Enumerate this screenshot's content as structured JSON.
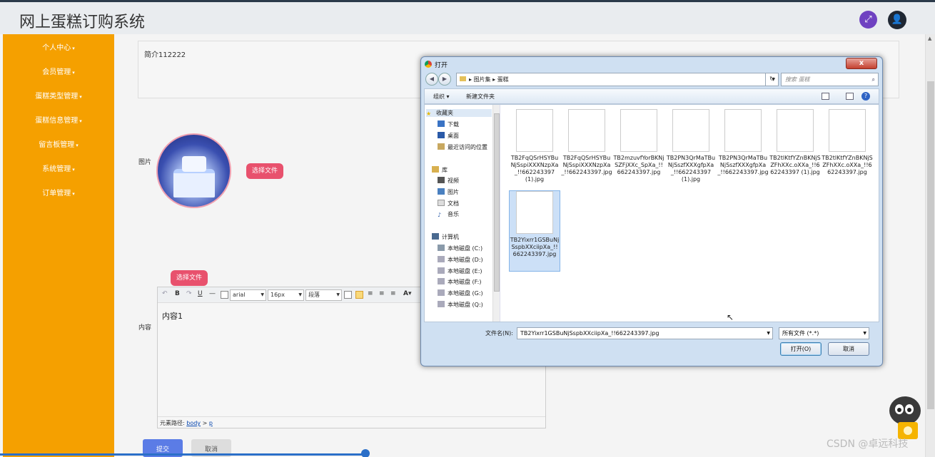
{
  "app": {
    "title": "网上蛋糕订购系统"
  },
  "header": {
    "fullscreen_icon": "expand-icon",
    "user_icon": "user-icon"
  },
  "sidebar": {
    "items": [
      {
        "label": "个人中心"
      },
      {
        "label": "会员管理"
      },
      {
        "label": "蛋糕类型管理"
      },
      {
        "label": "蛋糕信息管理"
      },
      {
        "label": "留言板管理"
      },
      {
        "label": "系统管理"
      },
      {
        "label": "订单管理"
      }
    ]
  },
  "form": {
    "intro_value": "简介112222",
    "image_label": "图片",
    "choose_file_label": "选择文件",
    "choose_file_label_2": "选择文件",
    "content_label": "内容",
    "submit_label": "提交",
    "cancel_label": "取消"
  },
  "editor": {
    "font_family": "arial",
    "font_size": "16px",
    "paragraph": "段落",
    "body_text": "内容1",
    "path_label": "元素路径:",
    "path_body": "body",
    "path_sep": ">",
    "path_p": "p"
  },
  "dialog": {
    "title": "打开",
    "close": "x",
    "breadcrumb_1": "图片集",
    "breadcrumb_2": "蛋糕",
    "search_placeholder": "搜索 蛋糕",
    "organize": "组织 ▾",
    "new_folder": "新建文件夹",
    "nav": {
      "favorites": "收藏夹",
      "downloads": "下载",
      "desktop": "桌面",
      "recent": "最近访问的位置",
      "libraries": "库",
      "videos": "视频",
      "pictures": "图片",
      "documents": "文档",
      "music": "音乐",
      "computer": "计算机",
      "drive_c": "本地磁盘 (C:)",
      "drive_d": "本地磁盘 (D:)",
      "drive_e": "本地磁盘 (E:)",
      "drive_f": "本地磁盘 (F:)",
      "drive_g": "本地磁盘 (G:)",
      "drive_q": "本地磁盘 (Q:)"
    },
    "files": [
      {
        "name": "TB2FqQSrHSYBuNjSspiXXXNzpXa_!!662243397 (1).jpg",
        "thumb": "frozen"
      },
      {
        "name": "TB2FqQSrHSYBuNjSspiXXXNzpXa_!!662243397.jpg",
        "thumb": "frozen"
      },
      {
        "name": "TB2mzuvfYorBKNjSZFjXXc_SpXa_!!662243397.jpg",
        "thumb": "text"
      },
      {
        "name": "TB2PN3QrMaTBuNjSszfXXXgfpXa_!!662243397 (1).jpg",
        "thumb": "pink"
      },
      {
        "name": "TB2PN3QrMaTBuNjSszfXXXgfpXa_!!662243397.jpg",
        "thumb": "pink"
      },
      {
        "name": "TB2tlKtfYZnBKNjSZFhXXc.oXXa_!!662243397 (1).jpg",
        "thumb": "grid"
      },
      {
        "name": "TB2tlKtfYZnBKNjSZFhXXc.oXXa_!!662243397.jpg",
        "thumb": "grid"
      },
      {
        "name": "TB2Yixrr1GSBuNjSspbXXciipXa_!!662243397.jpg",
        "thumb": "gray",
        "selected": true
      }
    ],
    "filename_label": "文件名(N):",
    "filename_value": "TB2Yixrr1GSBuNjSspbXXciipXa_!!662243397.jpg",
    "filetype_value": "所有文件 (*.*)",
    "open_label": "打开(O)",
    "cancel_label": "取消"
  },
  "watermark": "CSDN @卓远科技"
}
